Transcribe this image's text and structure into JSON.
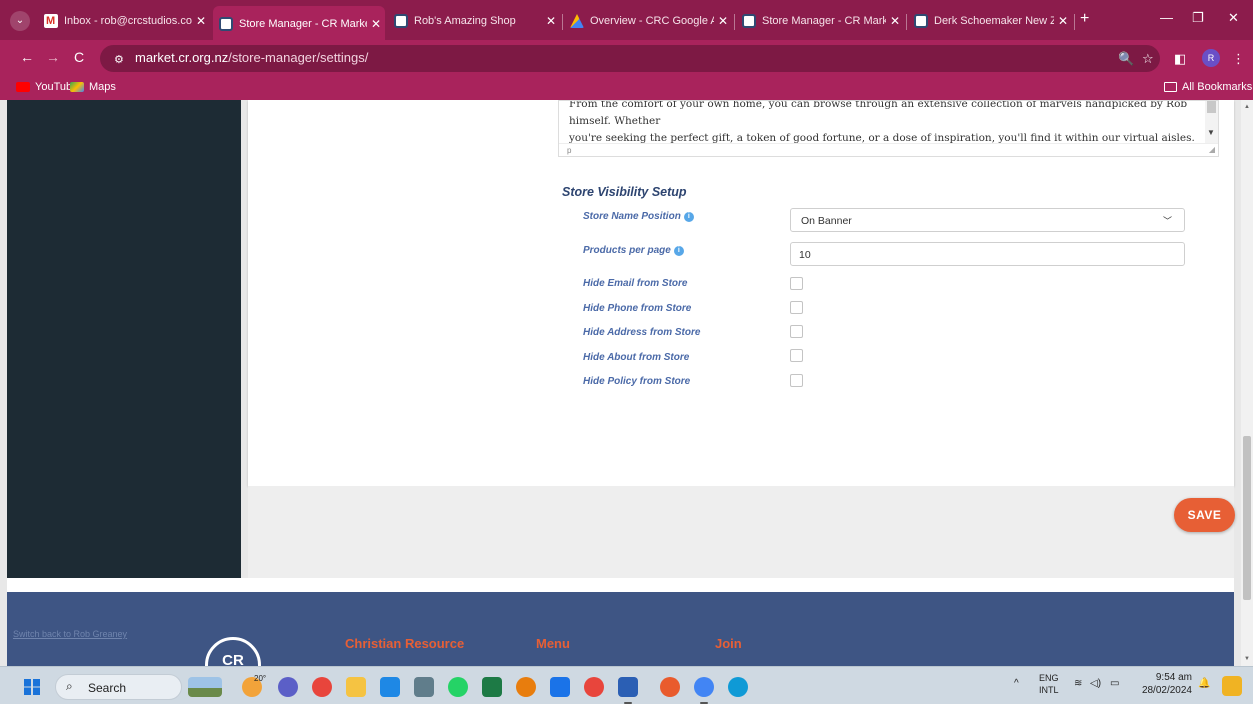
{
  "browser": {
    "tabs": [
      {
        "title": "Inbox - rob@crcstudios.co",
        "icon": "gmail-icon",
        "active": false
      },
      {
        "title": "Store Manager - CR Marke",
        "icon": "cr-market-icon",
        "active": true
      },
      {
        "title": "Rob's Amazing Shop",
        "icon": "cr-market-icon",
        "active": false
      },
      {
        "title": "Overview - CRC Google Ad",
        "icon": "google-ads-icon",
        "active": false
      },
      {
        "title": "Store Manager - CR Marke",
        "icon": "cr-market-icon",
        "active": false
      },
      {
        "title": "Derk Schoemaker New Ze",
        "icon": "cr-market-icon",
        "active": false
      }
    ],
    "new_tab": "+",
    "url_host": "market.cr.org.nz",
    "url_path": "/store-manager/settings/",
    "profile_initial": "R",
    "bookmarks": [
      {
        "label": "YouTube",
        "icon": "youtube-icon"
      },
      {
        "label": "Maps",
        "icon": "maps-icon"
      }
    ],
    "all_bookmarks": "All Bookmarks",
    "theme_color": "#a9235c"
  },
  "editor": {
    "line1": "From the comfort of your own home, you can browse through an extensive collection of marvels handpicked by Rob himself. Whether",
    "line2": "you're seeking the perfect gift, a token of good fortune, or a dose of inspiration, you'll find it within our virtual aisles.",
    "status": "p"
  },
  "visibility": {
    "title": "Store Visibility Setup",
    "store_name_position_label": "Store Name Position",
    "store_name_position_value": "On Banner",
    "products_per_page_label": "Products per page",
    "products_per_page_value": "10",
    "checkboxes": [
      {
        "label": "Hide Email from Store",
        "checked": false
      },
      {
        "label": "Hide Phone from Store",
        "checked": false
      },
      {
        "label": "Hide Address from Store",
        "checked": false
      },
      {
        "label": "Hide About from Store",
        "checked": false
      },
      {
        "label": "Hide Policy from Store",
        "checked": false
      }
    ]
  },
  "save_label": "SAVE",
  "footer": {
    "switch_link": "Switch back to Rob Greaney",
    "logo_text": "CR",
    "col1": "Christian Resource",
    "col2": "Menu",
    "col3": "Join"
  },
  "taskbar": {
    "search_label": "Search",
    "weather": "20°",
    "lang1": "ENG",
    "lang2": "INTL",
    "time": "9:54 am",
    "date": "28/02/2024"
  },
  "colors": {
    "sidebar": "#1d2b34",
    "accent_orange": "#e75f35",
    "label_blue": "#4b6aa8",
    "footer_blue": "#3e5584"
  }
}
